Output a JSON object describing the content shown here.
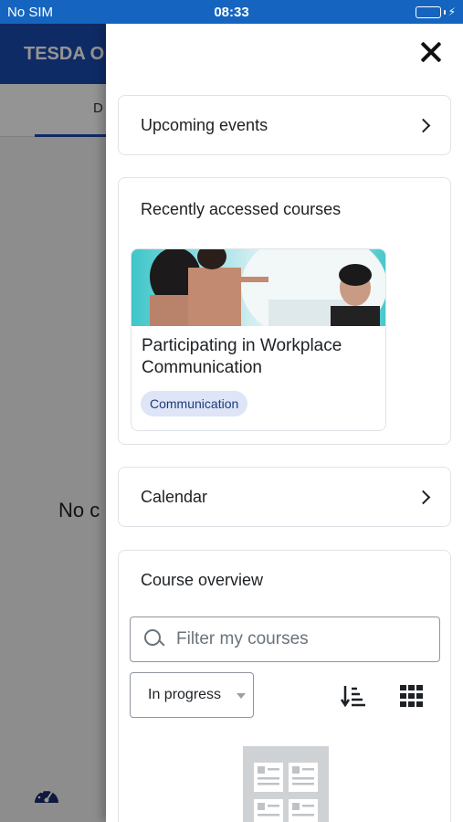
{
  "status_bar": {
    "carrier": "No SIM",
    "time": "08:33",
    "battery_level": 1.0
  },
  "background_app": {
    "header_title": "TESDA O",
    "tab_label": "D",
    "empty_message": "No c",
    "bottom_icon": "dashboard-icon"
  },
  "drawer": {
    "close_icon": "close-icon",
    "upcoming_events": {
      "title": "Upcoming events",
      "icon": "chevron-right-icon"
    },
    "recently_accessed": {
      "title": "Recently accessed courses",
      "courses": [
        {
          "name": "Participating in Workplace Communication",
          "category": "Communication"
        }
      ]
    },
    "calendar": {
      "title": "Calendar",
      "icon": "chevron-right-icon"
    },
    "course_overview": {
      "title": "Course overview",
      "search_placeholder": "Filter my courses",
      "filter_selected": "In progress",
      "sort_icon": "sort-icon",
      "view_icon": "grid-view-icon"
    }
  },
  "colors": {
    "status_bar": "#1565c0",
    "app_header": "#1a4bb0",
    "tag_bg": "#dde5f6",
    "tag_text": "#1d3b7a"
  }
}
